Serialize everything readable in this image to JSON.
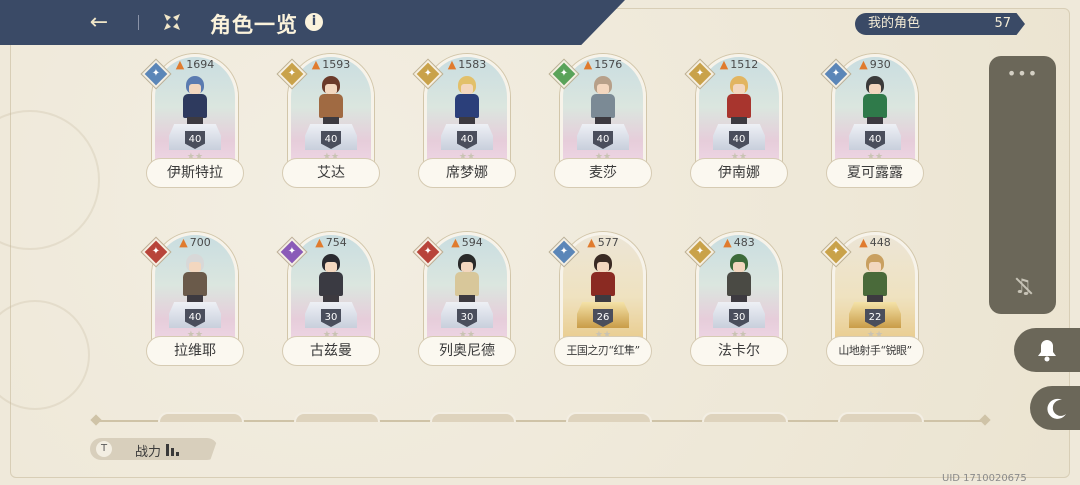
{
  "header": {
    "title": "角色一览",
    "owned_label": "我的角色",
    "owned_count": "57"
  },
  "characters": [
    {
      "name": "伊斯特拉",
      "power": "1694",
      "level": "40",
      "element": "blue",
      "frame": "blue",
      "hair": "#5b7bb0",
      "outfit": "#2e3a5e"
    },
    {
      "name": "艾达",
      "power": "1593",
      "level": "40",
      "element": "gold",
      "frame": "blue",
      "hair": "#6b3a2a",
      "outfit": "#a06a42"
    },
    {
      "name": "席梦娜",
      "power": "1583",
      "level": "40",
      "element": "gold",
      "frame": "blue",
      "hair": "#e2c06a",
      "outfit": "#2b3f7a"
    },
    {
      "name": "麦莎",
      "power": "1576",
      "level": "40",
      "element": "green",
      "frame": "blue",
      "hair": "#b7a089",
      "outfit": "#7b8a95"
    },
    {
      "name": "伊南娜",
      "power": "1512",
      "level": "40",
      "element": "gold",
      "frame": "blue",
      "hair": "#e2b560",
      "outfit": "#a8352e"
    },
    {
      "name": "夏可露露",
      "power": "930",
      "level": "40",
      "element": "blue",
      "frame": "blue",
      "hair": "#3a3a3a",
      "outfit": "#2f7a4a"
    },
    {
      "name": "拉维耶",
      "power": "700",
      "level": "40",
      "element": "red",
      "frame": "blue",
      "hair": "#d8d8d8",
      "outfit": "#6a5a4a"
    },
    {
      "name": "古兹曼",
      "power": "754",
      "level": "30",
      "element": "purple",
      "frame": "blue",
      "hair": "#2a2a30",
      "outfit": "#3a3a42"
    },
    {
      "name": "列奥尼德",
      "power": "594",
      "level": "30",
      "element": "red",
      "frame": "blue",
      "hair": "#2a2a2a",
      "outfit": "#d8c79a"
    },
    {
      "name": "王国之刃“红隼”",
      "power": "577",
      "level": "26",
      "element": "blue",
      "frame": "gold",
      "hair": "#3a2a24",
      "outfit": "#8a2a22"
    },
    {
      "name": "法卡尔",
      "power": "483",
      "level": "30",
      "element": "gold",
      "frame": "blue",
      "hair": "#3c6a3a",
      "outfit": "#4a4a44"
    },
    {
      "name": "山地射手“锐眼”",
      "power": "448",
      "level": "22",
      "element": "gold",
      "frame": "gold",
      "hair": "#c9a060",
      "outfit": "#4a6a3a"
    }
  ],
  "element_colors": {
    "blue": "#5b86b8",
    "gold": "#c9a24a",
    "green": "#5aa35a",
    "red": "#b8443a",
    "purple": "#8a5ab8"
  },
  "sort": {
    "label": "战力",
    "icon": "T"
  },
  "uid": "UID 1710020675",
  "side": {
    "more_icon": "•••",
    "music_icon": "music-off-icon",
    "bell_icon": "bell-icon",
    "moon_icon": "moon-icon"
  },
  "icons": {
    "back": "back-arrow-icon",
    "grid": "grid-icon",
    "info": "i",
    "flame": "🔥"
  }
}
